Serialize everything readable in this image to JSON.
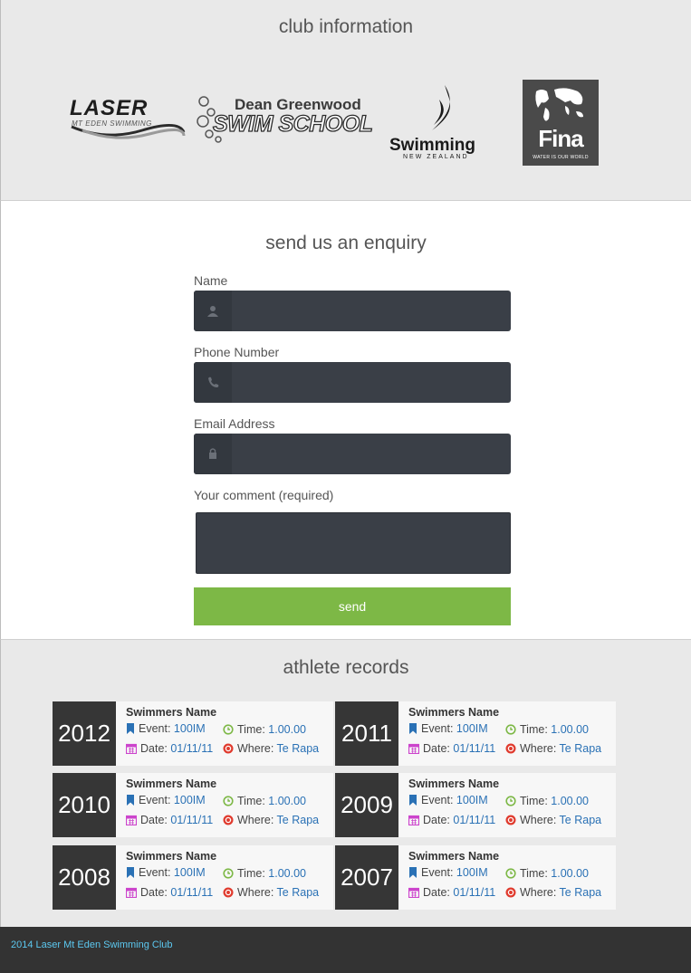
{
  "club": {
    "title": "club information",
    "logos": [
      {
        "name": "laser-mt-eden-swimming",
        "line1": "LASER",
        "line2": "MT EDEN SWIMMING"
      },
      {
        "name": "dean-greenwood-swim-school",
        "line1": "Dean Greenwood",
        "line2": "SWIM SCHOOL"
      },
      {
        "name": "swimming-new-zealand",
        "line1": "Swimming",
        "line2": "NEW ZEALAND"
      },
      {
        "name": "fina",
        "line1": "Fina",
        "line2": "WATER IS OUR WORLD"
      }
    ]
  },
  "enquiry": {
    "title": "send us an enquiry",
    "fields": [
      {
        "label": "Name",
        "icon": "user-icon",
        "value": ""
      },
      {
        "label": "Phone Number",
        "icon": "phone-icon",
        "value": ""
      },
      {
        "label": "Email Address",
        "icon": "lock-icon",
        "value": ""
      }
    ],
    "comment_label": "Your comment (required)",
    "send_label": "send"
  },
  "records": {
    "title": "athlete records",
    "labels": {
      "event": "Event:",
      "time": "Time:",
      "date": "Date:",
      "where": "Where:"
    },
    "items": [
      {
        "year": "2012",
        "name": "Swimmers Name",
        "event": "100IM",
        "time": "1.00.00",
        "date": "01/11/11",
        "where": "Te Rapa"
      },
      {
        "year": "2011",
        "name": "Swimmers Name",
        "event": "100IM",
        "time": "1.00.00",
        "date": "01/11/11",
        "where": "Te Rapa"
      },
      {
        "year": "2010",
        "name": "Swimmers Name",
        "event": "100IM",
        "time": "1.00.00",
        "date": "01/11/11",
        "where": "Te Rapa"
      },
      {
        "year": "2009",
        "name": "Swimmers Name",
        "event": "100IM",
        "time": "1.00.00",
        "date": "01/11/11",
        "where": "Te Rapa"
      },
      {
        "year": "2008",
        "name": "Swimmers Name",
        "event": "100IM",
        "time": "1.00.00",
        "date": "01/11/11",
        "where": "Te Rapa"
      },
      {
        "year": "2007",
        "name": "Swimmers Name",
        "event": "100IM",
        "time": "1.00.00",
        "date": "01/11/11",
        "where": "Te Rapa"
      }
    ]
  },
  "footer": {
    "text": "2014 Laser Mt Eden Swimming Club"
  },
  "colors": {
    "send_button": "#7db846",
    "input_bg": "#3a3f47",
    "year_bg": "#363636",
    "link": "#2a71b5",
    "event_icon": "#2a71b5",
    "time_icon": "#7db846",
    "date_icon": "#cc44cc",
    "where_icon": "#e03b2e",
    "footer_text": "#5cc8f0"
  }
}
